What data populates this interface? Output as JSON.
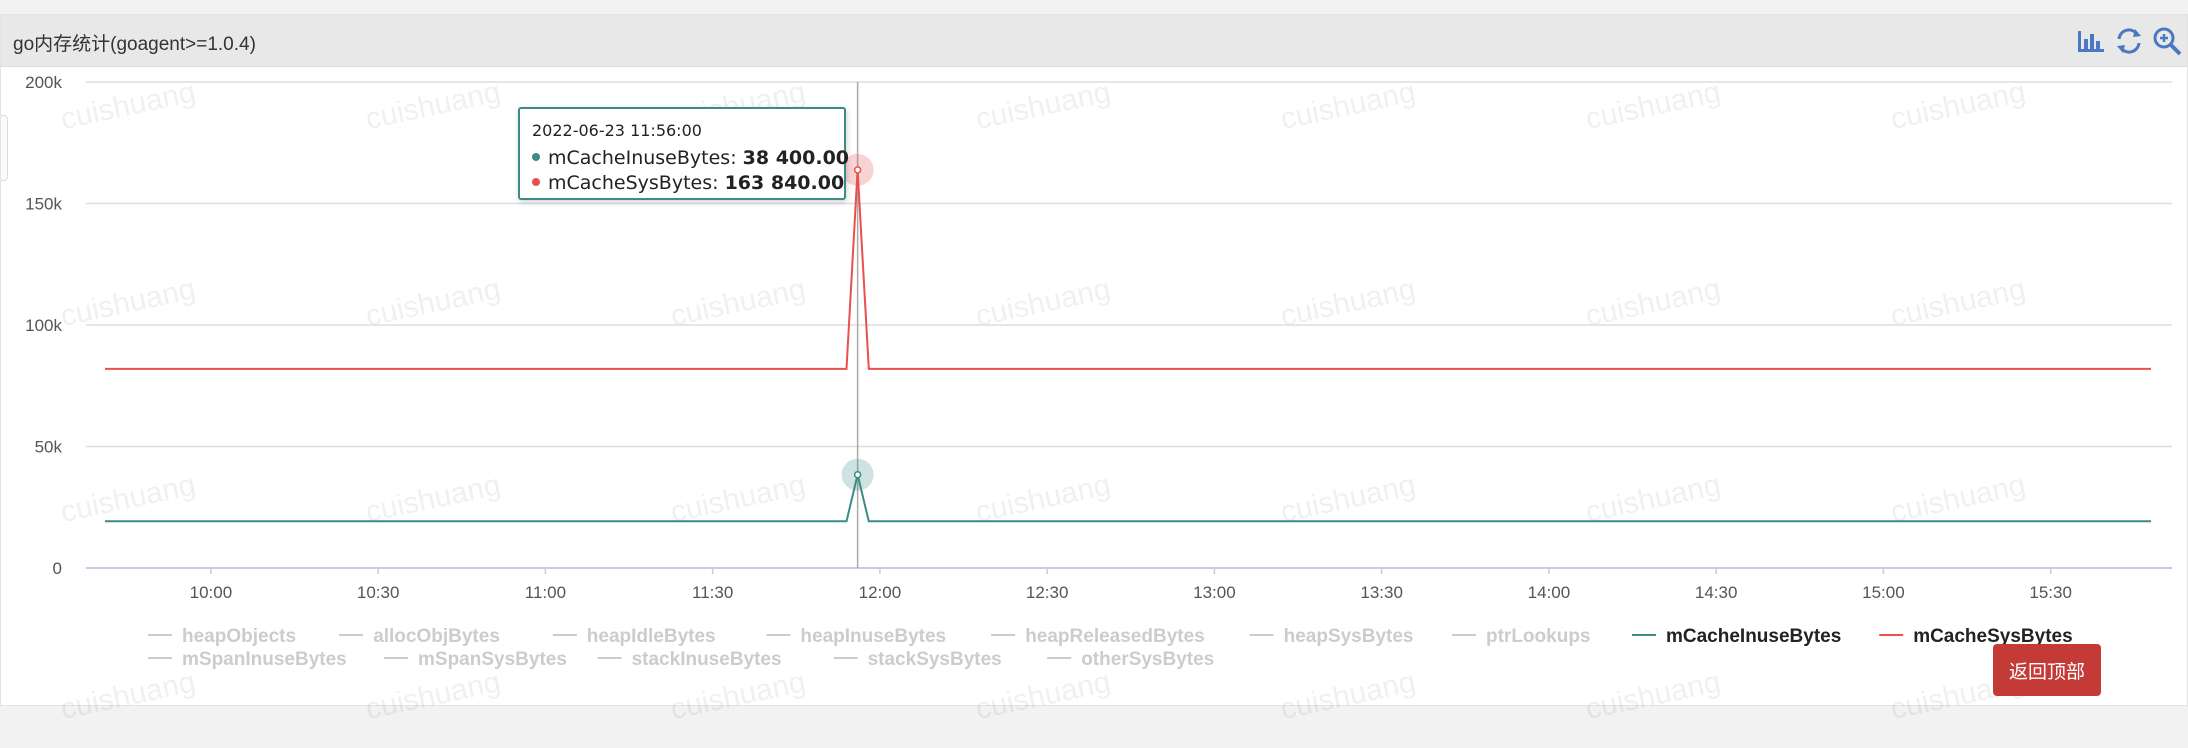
{
  "panel": {
    "title": "go内存统计(goagent>=1.0.4)",
    "toolbar": {
      "icons": [
        "bar-chart-icon",
        "refresh-icon",
        "zoom-icon"
      ],
      "icon_color": "#4a78c2"
    }
  },
  "watermark": "cuishuang",
  "tooltip": {
    "time": "2022-06-23 11:56:00",
    "rows": [
      {
        "name": "mCacheInuseBytes",
        "value": "38 400.00",
        "color": "#3d8a86"
      },
      {
        "name": "mCacheSysBytes",
        "value": "163 840.00",
        "color": "#e8514e"
      }
    ]
  },
  "back_to_top": "返回顶部",
  "chart_data": {
    "type": "line",
    "x_ticks": [
      "10:00",
      "10:30",
      "11:00",
      "11:30",
      "12:00",
      "12:30",
      "13:00",
      "13:30",
      "14:00",
      "14:30",
      "15:00",
      "15:30"
    ],
    "y_ticks": [
      "0",
      "50k",
      "100k",
      "150k",
      "200k"
    ],
    "ylim": [
      0,
      200000
    ],
    "xlim_minutes": [
      "09:41",
      "15:48"
    ],
    "grid": "horizontal",
    "hover_time": "11:56",
    "series": [
      {
        "name": "mCacheInuseBytes",
        "color": "#3d8a86",
        "points": [
          [
            "09:41",
            19200
          ],
          [
            "11:54",
            19200
          ],
          [
            "11:56",
            38400
          ],
          [
            "11:58",
            19200
          ],
          [
            "15:48",
            19200
          ]
        ]
      },
      {
        "name": "mCacheSysBytes",
        "color": "#e8514e",
        "points": [
          [
            "09:41",
            81920
          ],
          [
            "11:54",
            81920
          ],
          [
            "11:56",
            163840
          ],
          [
            "11:58",
            81920
          ],
          [
            "15:48",
            81920
          ]
        ]
      }
    ],
    "legend": {
      "position": "bottom",
      "active_color": "#222222",
      "inactive_color": "#cccccc",
      "rows": [
        [
          {
            "name": "heapObjects",
            "active": false
          },
          {
            "name": "allocObjBytes",
            "active": false
          },
          {
            "name": "heapIdleBytes",
            "active": false
          },
          {
            "name": "heapInuseBytes",
            "active": false
          },
          {
            "name": "heapReleasedBytes",
            "active": false
          },
          {
            "name": "heapSysBytes",
            "active": false
          },
          {
            "name": "ptrLookups",
            "active": false
          },
          {
            "name": "mCacheInuseBytes",
            "active": true,
            "color": "#3d8a86"
          },
          {
            "name": "mCacheSysBytes",
            "active": true,
            "color": "#e8514e"
          }
        ],
        [
          {
            "name": "mSpanInuseBytes",
            "active": false
          },
          {
            "name": "mSpanSysBytes",
            "active": false
          },
          {
            "name": "stackInuseBytes",
            "active": false
          },
          {
            "name": "stackSysBytes",
            "active": false
          },
          {
            "name": "otherSysBytes",
            "active": false
          }
        ]
      ]
    }
  }
}
